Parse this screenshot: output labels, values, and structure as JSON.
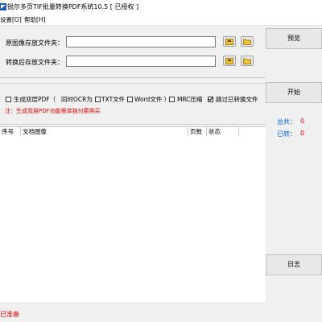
{
  "window": {
    "title": "锐尔多页TIF批量转换PDF系统10.5 [ 已授权 ]"
  },
  "menu": {
    "items": [
      "设置[O]",
      "帮助[H]"
    ]
  },
  "paths": {
    "source_label": "原图像存放文件夹：",
    "source_value": "",
    "target_label": "转换后存放文件夹：",
    "target_value": ""
  },
  "options": {
    "double_layer_pdf": {
      "label": "生成双层PDF（",
      "checked": false
    },
    "ocr_to": {
      "label": "同时OCR为",
      "checked": false
    },
    "txt": {
      "label": "TXT文件",
      "checked": false
    },
    "word": {
      "label": "Word文件 ）",
      "checked": false
    },
    "mrc": {
      "label": "MRC压缩",
      "checked": false
    },
    "skip_converted": {
      "label": "跳过已转换文件",
      "checked": true
    },
    "note": "注：生成双层PDF功能需单独付费购买"
  },
  "table": {
    "columns": [
      "序号",
      "文档图像",
      "页数",
      "状态"
    ],
    "rows": []
  },
  "buttons": {
    "preview": "预览",
    "start": "开始",
    "log": "日志"
  },
  "stats": {
    "total_label": "总共：",
    "total_value": "0",
    "done_label": "已转：",
    "done_value": "0"
  },
  "status_text": "已准备",
  "colors": {
    "accent_blue": "#0066dd",
    "alert_red": "#e00000"
  }
}
